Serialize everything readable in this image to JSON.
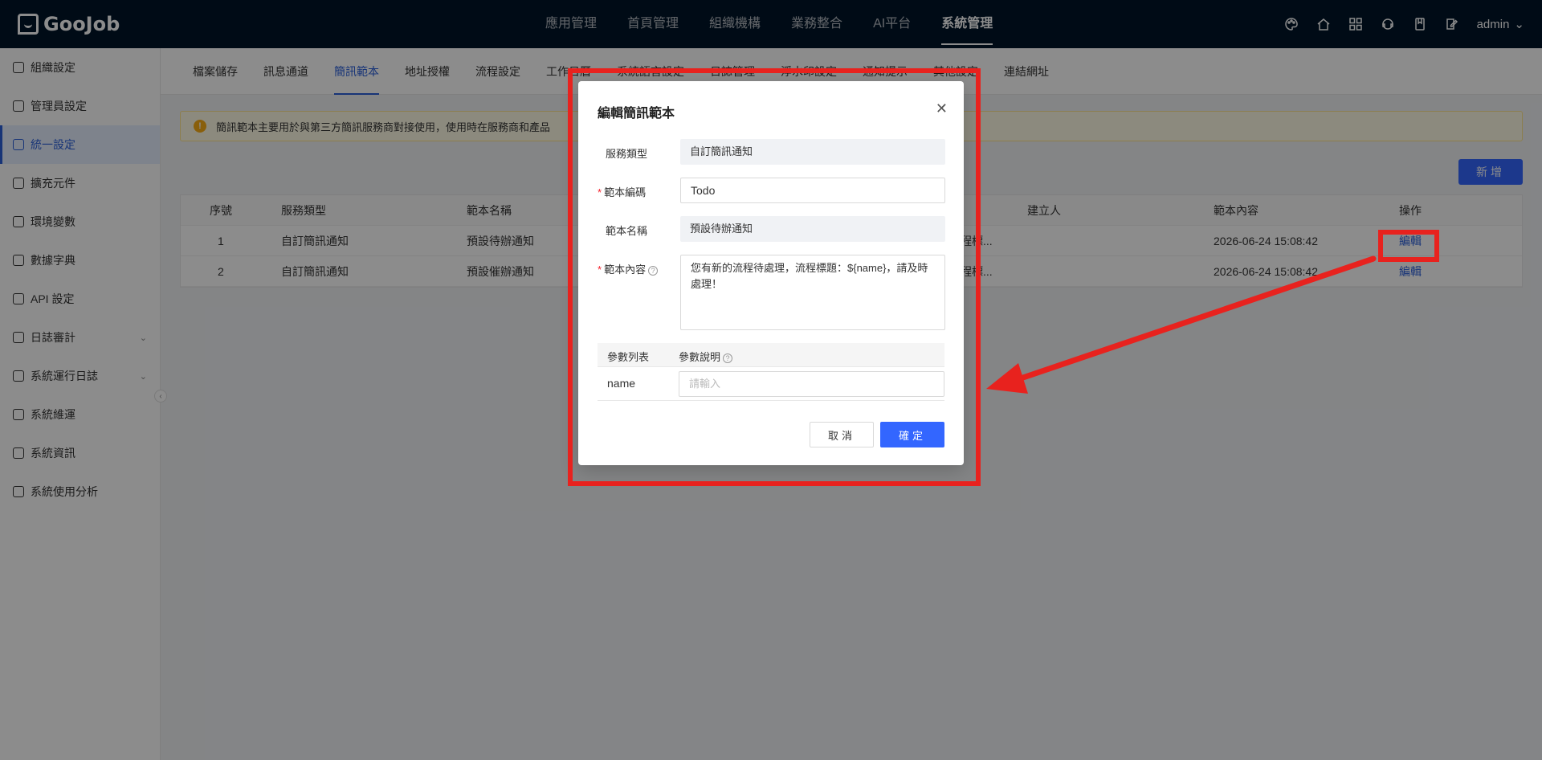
{
  "topbar": {
    "logo": "GooJob",
    "nav": [
      "應用管理",
      "首頁管理",
      "組織機構",
      "業務整合",
      "AI平台",
      "系統管理"
    ],
    "active_nav": 5,
    "user": "admin"
  },
  "sidebar": {
    "items": [
      {
        "label": "組織設定",
        "icon": "settings-icon"
      },
      {
        "label": "管理員設定",
        "icon": "user-icon"
      },
      {
        "label": "統一設定",
        "icon": "cluster-icon"
      },
      {
        "label": "擴充元件",
        "icon": "box-icon"
      },
      {
        "label": "環境變數",
        "icon": "keyboard-icon"
      },
      {
        "label": "數據字典",
        "icon": "book-icon"
      },
      {
        "label": "API 設定",
        "icon": "api-icon"
      },
      {
        "label": "日誌審計",
        "icon": "log-icon"
      },
      {
        "label": "系統運行日誌",
        "icon": "log-icon"
      },
      {
        "label": "系統維運",
        "icon": "monitor-icon"
      },
      {
        "label": "系統資訊",
        "icon": "info-icon"
      },
      {
        "label": "系統使用分析",
        "icon": "chart-icon"
      }
    ],
    "active_index": 2
  },
  "tabs": [
    "檔案儲存",
    "訊息通道",
    "簡訊範本",
    "地址授權",
    "流程設定",
    "工作日曆",
    "系統語言設定",
    "日誌管理",
    "浮水印設定",
    "通知提示",
    "其他設定",
    "連結網址"
  ],
  "active_tab": 2,
  "alert": {
    "text": "簡訊範本主要用於與第三方簡訊服務商對接使用，使用時在服務商和產品"
  },
  "add_button": "新增",
  "table": {
    "headers": [
      "序號",
      "服務類型",
      "範本名稱",
      "建立人",
      "範本內容",
      "操作"
    ],
    "rows": [
      {
        "no": "1",
        "type": "自訂簡訊通知",
        "name": "預設待辦通知",
        "content_partial": "流程標...",
        "created": "2026-06-24 15:08:42",
        "action": "編輯"
      },
      {
        "no": "2",
        "type": "自訂簡訊通知",
        "name": "預設催辦通知",
        "content_partial": "流程標...",
        "created": "2026-06-24 15:08:42",
        "action": "編輯"
      }
    ]
  },
  "modal": {
    "title": "編輯簡訊範本",
    "service_type_label": "服務類型",
    "service_type_value": "自訂簡訊通知",
    "code_label": "範本編碼",
    "code_value": "Todo",
    "name_label": "範本名稱",
    "name_value": "預設待辦通知",
    "content_label": "範本內容",
    "content_value": "您有新的流程待處理，流程標題：${name}，請及時處理！",
    "param_list_header": "參數列表",
    "param_desc_header": "參數說明",
    "params": [
      {
        "name": "name",
        "placeholder": "請輸入"
      }
    ],
    "cancel": "取消",
    "ok": "確定"
  },
  "colors": {
    "primary": "#3366ff",
    "topbar": "#001529",
    "annotation": "#e8221e"
  }
}
